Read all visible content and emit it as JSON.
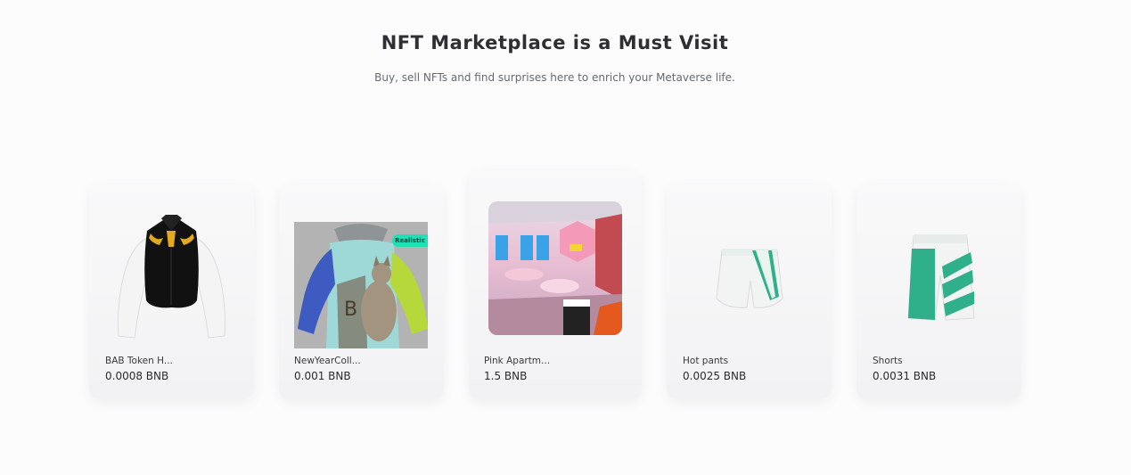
{
  "header": {
    "title": "NFT Marketplace is a Must Visit",
    "subtitle": "Buy, sell NFTs and find surprises here to enrich your Metaverse life."
  },
  "cards": [
    {
      "name": "BAB Token H...",
      "price": "0.0008 BNB",
      "image": "jacket-image"
    },
    {
      "name": "NewYearColl...",
      "price": "0.001 BNB",
      "image": "hoodie-image",
      "badge": "Realistic"
    },
    {
      "name": "Pink Apartm...",
      "price": "1.5 BNB",
      "image": "apartment-image"
    },
    {
      "name": "Hot pants",
      "price": "0.0025 BNB",
      "image": "hot-pants-image"
    },
    {
      "name": "Shorts",
      "price": "0.0031 BNB",
      "image": "shorts-image"
    }
  ],
  "colors": {
    "background": "#fcfcfd",
    "badge": "#1ee0b4",
    "accent_green": "#2fb08a"
  }
}
